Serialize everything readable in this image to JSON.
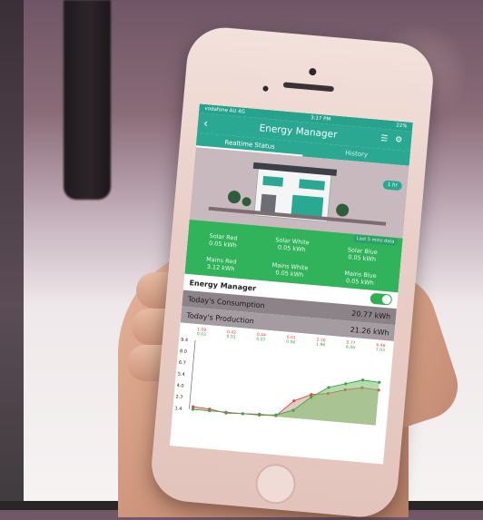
{
  "status_bar": {
    "carrier": "vodafone AU  4G",
    "time": "3:17 PM",
    "battery": "22%"
  },
  "app": {
    "title": "Energy Manager"
  },
  "tabs": [
    {
      "label": "Realtime Status"
    },
    {
      "label": "History"
    }
  ],
  "house_badge": "1 hr",
  "last_mins": "Last 5 mins data",
  "readings": [
    {
      "label": "Solar Red",
      "value": "0.05 kWh"
    },
    {
      "label": "Solar White",
      "value": "0.05 kWh"
    },
    {
      "label": "Solar Blue",
      "value": "0.05 kWh"
    },
    {
      "label": "Mains Red",
      "value": "3.12 kWh"
    },
    {
      "label": "Mains White",
      "value": "0.05 kWh"
    },
    {
      "label": "Mains Blue",
      "value": "0.05 kWh"
    }
  ],
  "energy_manager": {
    "label": "Energy Manager",
    "enabled": true
  },
  "consumption": {
    "label": "Today's Consumption",
    "value": "20.77 kWh"
  },
  "production": {
    "label": "Today's Production",
    "value": "21.26 kWh"
  },
  "chart_data": {
    "type": "area",
    "yticks": [
      "9.4",
      "8.0",
      "6.7",
      "5.4",
      "4.0",
      "2.7",
      "1.4"
    ],
    "ylim": [
      1.4,
      9.4
    ],
    "top_labels": [
      {
        "red": "1.09",
        "green": "0.03"
      },
      {
        "red": "0.42",
        "green": "0.03"
      },
      {
        "red": "0.44",
        "green": "0.07"
      },
      {
        "red": "0.01",
        "green": "0.06"
      },
      {
        "red": "2.16",
        "green": "1.96"
      },
      {
        "red": "5.77",
        "green": "6.06"
      },
      {
        "red": "6.46",
        "green": "7.03"
      }
    ],
    "series": [
      {
        "color": "#e0453d",
        "values": [
          1.7,
          1.6,
          1.3,
          1.4,
          1.5,
          1.5,
          3.4,
          4.3,
          4.6,
          5.2,
          5.6,
          5.5
        ]
      },
      {
        "color": "#3aa64c",
        "values": [
          1.4,
          1.4,
          1.4,
          1.4,
          1.4,
          1.6,
          2.3,
          4.0,
          5.3,
          5.9,
          6.5,
          6.4
        ]
      }
    ]
  }
}
